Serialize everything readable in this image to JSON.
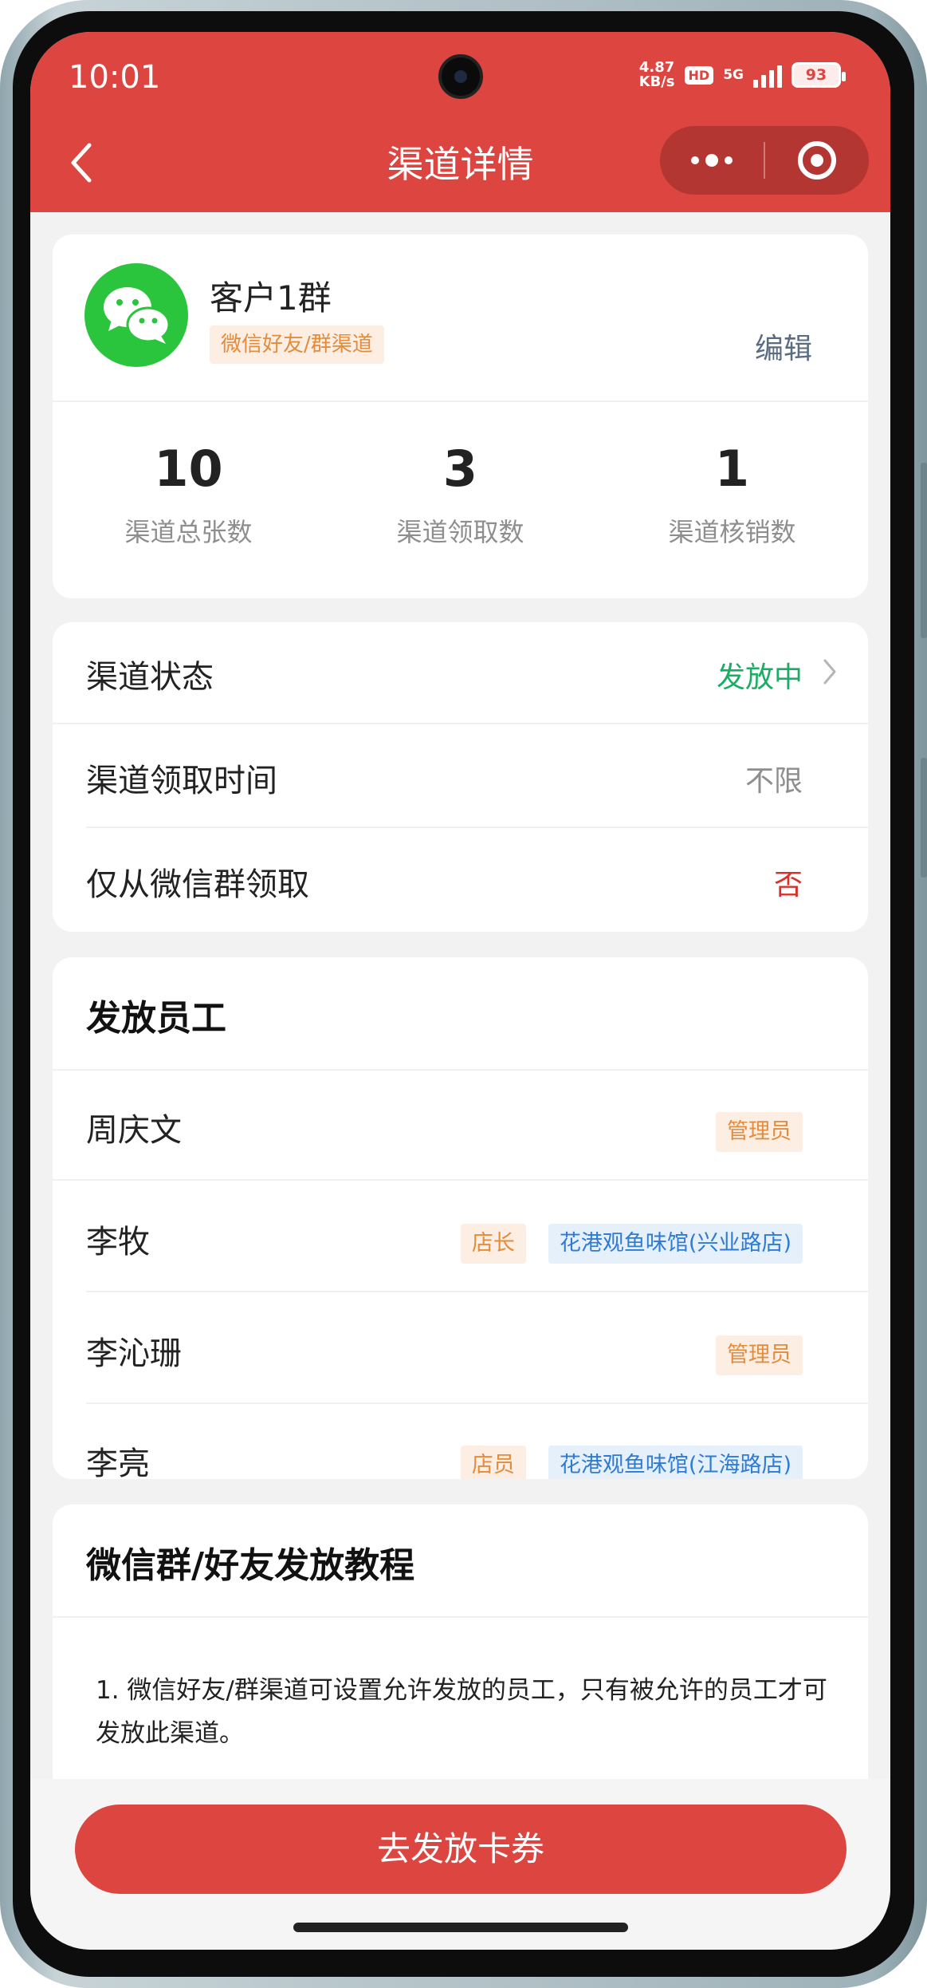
{
  "status_bar": {
    "time": "10:01",
    "net_speed_top": "4.87",
    "net_speed_bottom": "KB/s",
    "hd": "HD",
    "network": "5G",
    "battery": "93"
  },
  "nav": {
    "title": "渠道详情"
  },
  "channel": {
    "name": "客户1群",
    "tag": "微信好友/群渠道",
    "edit_label": "编辑"
  },
  "stats": [
    {
      "value": "10",
      "label": "渠道总张数"
    },
    {
      "value": "3",
      "label": "渠道领取数"
    },
    {
      "value": "1",
      "label": "渠道核销数"
    }
  ],
  "details": {
    "status_label": "渠道状态",
    "status_value": "发放中",
    "status_color": "#1aad63",
    "time_label": "渠道领取时间",
    "time_value": "不限",
    "group_only_label": "仅从微信群领取",
    "group_only_value": "否",
    "group_only_color": "#d9302c"
  },
  "employees": {
    "title": "发放员工",
    "list": [
      {
        "name": "周庆文",
        "role": "管理员",
        "store": ""
      },
      {
        "name": "李牧",
        "role": "店长",
        "store": "花港观鱼味馆(兴业路店)"
      },
      {
        "name": "李沁珊",
        "role": "管理员",
        "store": ""
      },
      {
        "name": "李亮",
        "role": "店员",
        "store": "花港观鱼味馆(江海路店)"
      }
    ]
  },
  "tutorial": {
    "title": "微信群/好友发放教程",
    "text": "1. 微信好友/群渠道可设置允许发放的员工，只有被允许的员工才可发放此渠道。"
  },
  "cta": {
    "label": "去发放卡券"
  },
  "colors": {
    "brand_red": "#dd4540",
    "wechat_green": "#2bc43d"
  }
}
